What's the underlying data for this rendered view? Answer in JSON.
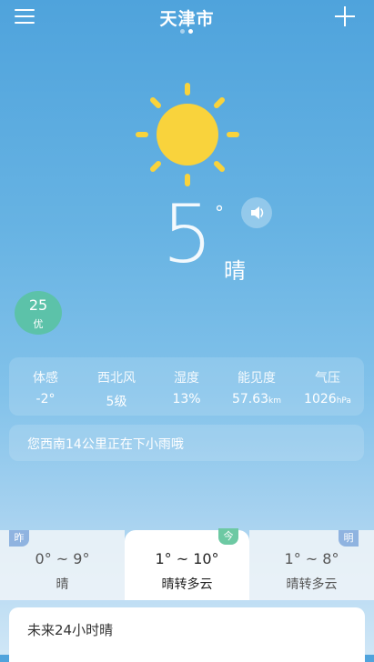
{
  "header": {
    "city": "天津市"
  },
  "current": {
    "temperature": "5",
    "degree_symbol": "°",
    "condition": "晴",
    "aqi": {
      "value": "25",
      "level": "优"
    }
  },
  "stats": [
    {
      "label": "体感",
      "value": "-2°",
      "unit": ""
    },
    {
      "label": "西北风",
      "value": "5级",
      "unit": ""
    },
    {
      "label": "湿度",
      "value": "13%",
      "unit": ""
    },
    {
      "label": "能见度",
      "value": "57.63",
      "unit": "km"
    },
    {
      "label": "气压",
      "value": "1026",
      "unit": "hPa"
    }
  ],
  "rain_notice": "您西南14公里正在下小雨哦",
  "forecast": [
    {
      "tag": "昨",
      "range": "0° ~ 9°",
      "condition": "晴"
    },
    {
      "tag": "今",
      "range": "1° ~ 10°",
      "condition": "晴转多云"
    },
    {
      "tag": "明",
      "range": "1° ~ 8°",
      "condition": "晴转多云"
    }
  ],
  "hourly_title": "未来24小时晴",
  "colors": {
    "sun": "#f9d33c",
    "aqi_good": "#5cc2a9",
    "today_tag": "#6dc9a3"
  },
  "icons": [
    "menu-icon",
    "add-icon",
    "sun-icon",
    "speaker-icon"
  ]
}
